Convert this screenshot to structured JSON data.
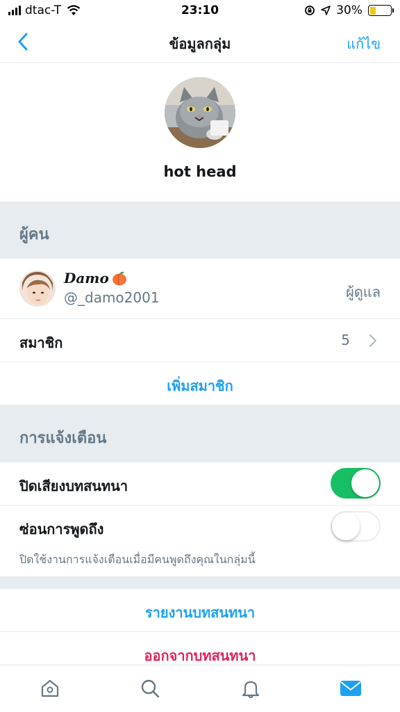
{
  "status_bar": {
    "carrier": "dtac-T",
    "time": "23:10",
    "battery_percent": "30%",
    "battery_level": 0.3,
    "icons": [
      "signal-bars-icon",
      "wifi-icon",
      "screen-lock-icon",
      "location-arrow-icon",
      "battery-icon"
    ]
  },
  "nav": {
    "back_icon": "chevron-left-icon",
    "title": "ข้อมูลกลุ่ม",
    "edit_label": "แก้ไข"
  },
  "group": {
    "name": "hot head",
    "avatar": "grumpy-cat-photo"
  },
  "people_section": {
    "header": "ผู้คน",
    "member": {
      "display_name": "Damo",
      "emoji": "peach-emoji",
      "handle": "@_damo2001",
      "role": "ผู้ดูแล"
    },
    "members_row": {
      "label": "สมาชิก",
      "count": "5"
    },
    "add_member_label": "เพิ่มสมาชิก"
  },
  "notifications_section": {
    "header": "การแจ้งเตือน",
    "mute_conversation": {
      "label": "ปิดเสียงบทสนทนา",
      "enabled": true
    },
    "hide_mentions": {
      "label": "ซ่อนการพูดถึง",
      "enabled": false
    },
    "hint": "ปิดใช้งานการแจ้งเตือนเมื่อมีคนพูดถึงคุณในกลุ่มนี้"
  },
  "actions": {
    "report_label": "รายงานบทสนทนา",
    "leave_label": "ออกจากบทสนทนา"
  },
  "tabbar": {
    "tabs": [
      "home-icon",
      "search-icon",
      "notifications-bell-icon",
      "messages-envelope-icon"
    ],
    "active": "messages-envelope-icon"
  },
  "colors": {
    "accent": "#1da1f2",
    "danger": "#e0245e",
    "toggle_on": "#17bf63",
    "section_bg": "#e6ecf0",
    "secondary_text": "#657786"
  }
}
